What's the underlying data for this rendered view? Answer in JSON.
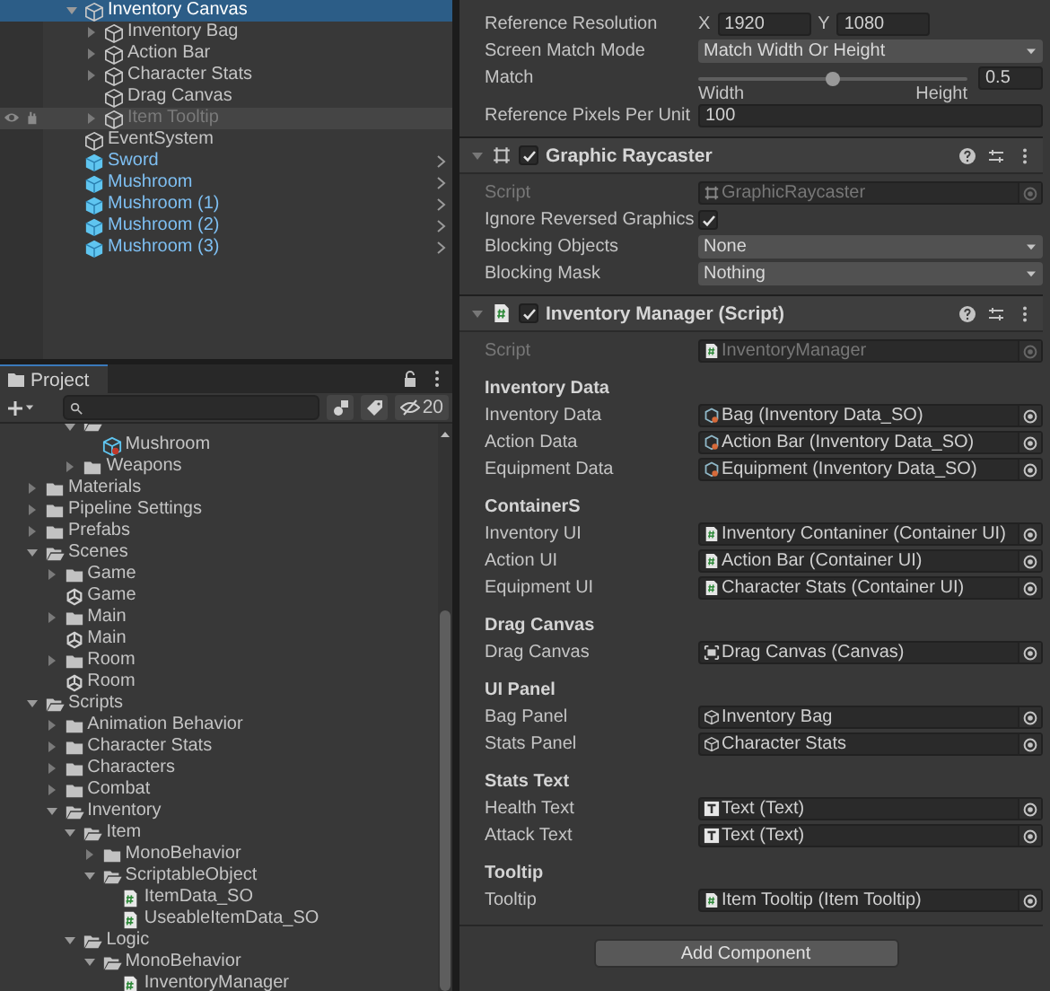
{
  "hierarchy": {
    "items": [
      {
        "label": "Inventory Canvas",
        "kind": "object",
        "expanded": true,
        "selected": true,
        "hovered": false,
        "disabled": false,
        "children": [
          {
            "label": "Inventory Bag",
            "kind": "object",
            "expanded": false,
            "selected": false,
            "hovered": false,
            "disabled": false
          },
          {
            "label": "Action Bar",
            "kind": "object",
            "expanded": false,
            "selected": false,
            "hovered": false,
            "disabled": false
          },
          {
            "label": "Character Stats",
            "kind": "object",
            "expanded": false,
            "selected": false,
            "hovered": false,
            "disabled": false
          },
          {
            "label": "Drag Canvas",
            "kind": "object",
            "selected": false,
            "hovered": false,
            "disabled": false
          },
          {
            "label": "Item Tooltip",
            "kind": "object",
            "expanded": false,
            "selected": false,
            "hovered": true,
            "disabled": true
          }
        ]
      },
      {
        "label": "EventSystem",
        "kind": "object",
        "selected": false,
        "hovered": false,
        "disabled": false
      },
      {
        "label": "Sword",
        "kind": "prefab",
        "selected": false,
        "hovered": false,
        "disabled": false
      },
      {
        "label": "Mushroom",
        "kind": "prefab",
        "selected": false,
        "hovered": false,
        "disabled": false
      },
      {
        "label": "Mushroom (1)",
        "kind": "prefab",
        "selected": false,
        "hovered": false,
        "disabled": false
      },
      {
        "label": "Mushroom (2)",
        "kind": "prefab",
        "selected": false,
        "hovered": false,
        "disabled": false
      },
      {
        "label": "Mushroom (3)",
        "kind": "prefab",
        "selected": false,
        "hovered": false,
        "disabled": false
      }
    ]
  },
  "project": {
    "tab": "Project",
    "hidden_count": "20",
    "tree_partial": [
      {
        "kind": "folder",
        "expanded": true,
        "children": [
          {
            "label": "Mushroom",
            "kind": "prefab"
          }
        ]
      },
      {
        "label": "Weapons",
        "kind": "folder",
        "expanded": false
      }
    ],
    "tree": [
      {
        "label": "Materials",
        "kind": "folder",
        "expanded": false
      },
      {
        "label": "Pipeline Settings",
        "kind": "folder",
        "expanded": false
      },
      {
        "label": "Prefabs",
        "kind": "folder",
        "expanded": false
      },
      {
        "label": "Scenes",
        "kind": "folder",
        "expanded": true,
        "children": [
          {
            "label": "Game",
            "kind": "folder",
            "expanded": false
          },
          {
            "label": "Game",
            "kind": "scene"
          },
          {
            "label": "Main",
            "kind": "folder",
            "expanded": false
          },
          {
            "label": "Main",
            "kind": "scene"
          },
          {
            "label": "Room",
            "kind": "folder",
            "expanded": false
          },
          {
            "label": "Room",
            "kind": "scene"
          }
        ]
      },
      {
        "label": "Scripts",
        "kind": "folder",
        "expanded": true,
        "children": [
          {
            "label": "Animation Behavior",
            "kind": "folder",
            "expanded": false
          },
          {
            "label": "Character Stats",
            "kind": "folder",
            "expanded": false
          },
          {
            "label": "Characters",
            "kind": "folder",
            "expanded": false
          },
          {
            "label": "Combat",
            "kind": "folder",
            "expanded": false
          },
          {
            "label": "Inventory",
            "kind": "folder",
            "expanded": true,
            "children": [
              {
                "label": "Item",
                "kind": "folder",
                "expanded": true,
                "children": [
                  {
                    "label": "MonoBehavior",
                    "kind": "folder",
                    "expanded": false
                  },
                  {
                    "label": "ScriptableObject",
                    "kind": "folder",
                    "expanded": true,
                    "children": [
                      {
                        "label": "ItemData_SO",
                        "kind": "script"
                      },
                      {
                        "label": "UseableItemData_SO",
                        "kind": "script"
                      }
                    ]
                  }
                ]
              },
              {
                "label": "Logic",
                "kind": "folder",
                "expanded": true,
                "children": [
                  {
                    "label": "MonoBehavior",
                    "kind": "folder",
                    "expanded": true,
                    "children": [
                      {
                        "label": "InventoryManager",
                        "kind": "script"
                      }
                    ]
                  }
                ]
              }
            ]
          }
        ]
      }
    ]
  },
  "inspector": {
    "rows": [
      {
        "kind": "vector",
        "label": "Reference Resolution",
        "fields": [
          {
            "axis": "X",
            "value": "1920"
          },
          {
            "axis": "Y",
            "value": "1080"
          }
        ]
      },
      {
        "kind": "dropdown",
        "label": "Screen Match Mode",
        "value": "Match Width Or Height"
      },
      {
        "kind": "slider",
        "label": "Match",
        "level": 0.5,
        "value": "0.5",
        "min_label": "Width",
        "max_label": "Height"
      },
      {
        "kind": "text",
        "label": "Reference Pixels Per Unit",
        "value": "100"
      }
    ],
    "components": [
      {
        "title": "Graphic Raycaster",
        "enabled": true,
        "rows": [
          {
            "kind": "object-rect",
            "label": "Script",
            "value": "GraphicRaycaster",
            "disabled": true
          },
          {
            "kind": "checkbox",
            "label": "Ignore Reversed Graphics",
            "checked": true
          },
          {
            "kind": "dropdown",
            "label": "Blocking Objects",
            "value": "None"
          },
          {
            "kind": "dropdown",
            "label": "Blocking Mask",
            "value": "Nothing"
          }
        ]
      },
      {
        "title": "Inventory Manager (Script)",
        "enabled": true,
        "rows": [
          {
            "kind": "object-script",
            "label": "Script",
            "value": "InventoryManager",
            "disabled": true
          },
          {
            "kind": "heading",
            "label": "Inventory Data"
          },
          {
            "kind": "object-scriptable",
            "label": "Inventory Data",
            "value": "Bag (Inventory Data_SO)",
            "disabled": false
          },
          {
            "kind": "object-scriptable",
            "label": "Action Data",
            "value": "Action Bar (Inventory Data_SO)",
            "disabled": false
          },
          {
            "kind": "object-scriptable",
            "label": "Equipment Data",
            "value": "Equipment (Inventory Data_SO)",
            "disabled": false
          },
          {
            "kind": "heading",
            "label": "ContainerS"
          },
          {
            "kind": "object-script",
            "label": "Inventory UI",
            "value": "Inventory Contaniner (Container UI)",
            "disabled": false
          },
          {
            "kind": "object-script",
            "label": "Action UI",
            "value": "Action Bar (Container UI)",
            "disabled": false
          },
          {
            "kind": "object-script",
            "label": "Equipment UI",
            "value": "Character Stats (Container UI)",
            "disabled": false
          },
          {
            "kind": "heading",
            "label": "Drag Canvas"
          },
          {
            "kind": "object-canvas",
            "label": "Drag Canvas",
            "value": "Drag Canvas (Canvas)",
            "disabled": false
          },
          {
            "kind": "heading",
            "label": "UI Panel"
          },
          {
            "kind": "object-cube",
            "label": "Bag Panel",
            "value": "Inventory Bag",
            "disabled": false
          },
          {
            "kind": "object-cube",
            "label": "Stats Panel",
            "value": "Character Stats",
            "disabled": false
          },
          {
            "kind": "heading",
            "label": "Stats Text"
          },
          {
            "kind": "object-text",
            "label": "Health Text",
            "value": "Text (Text)",
            "disabled": false
          },
          {
            "kind": "object-text",
            "label": "Attack Text",
            "value": "Text (Text)",
            "disabled": false
          },
          {
            "kind": "heading",
            "label": "Tooltip"
          },
          {
            "kind": "object-script",
            "label": "Tooltip",
            "value": "Item Tooltip (Item Tooltip)",
            "disabled": false
          }
        ]
      }
    ],
    "add_button": "Add Component"
  }
}
